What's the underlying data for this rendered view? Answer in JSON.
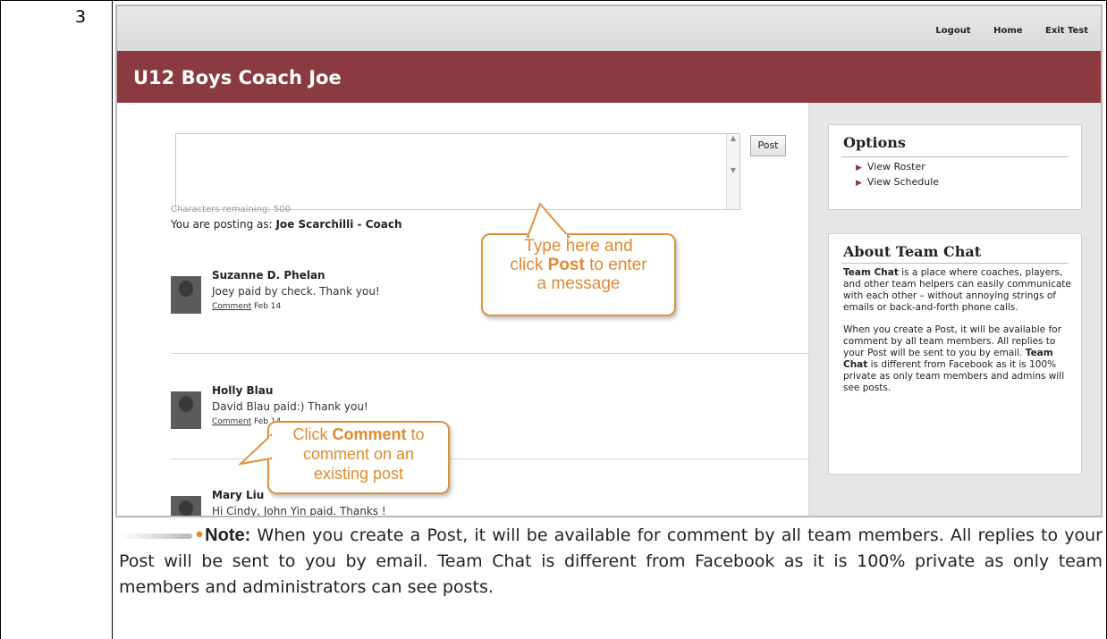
{
  "step_number": "3",
  "app": {
    "top_links": [
      "Logout",
      "Home",
      "Exit Test"
    ],
    "banner_title": "U12 Boys Coach Joe",
    "post_button": "Post",
    "chars_remaining": "Characters remaining: 500",
    "posting_as_prefix": "You are posting as: ",
    "posting_as_name": "Joe Scarchilli - Coach",
    "posts": [
      {
        "name": "Suzanne D. Phelan",
        "text": "Joey paid by check. Thank you!",
        "comment_label": "Comment",
        "date": "Feb 14"
      },
      {
        "name": "Holly Blau",
        "text": "David Blau paid:) Thank you!",
        "comment_label": "Comment",
        "date": "Feb 14"
      },
      {
        "name": "Mary Liu",
        "text": "Hi Cindy, John Yin paid. Thanks !",
        "comment_label": "",
        "date": ""
      }
    ]
  },
  "sidebar": {
    "options_title": "Options",
    "options": [
      "View Roster",
      "View Schedule"
    ],
    "about_title": "About Team Chat",
    "about_p1_bold": "Team Chat",
    "about_p1_rest": " is a place where coaches, players, and other team helpers can easily communicate with each other – without annoying strings of emails or back-and-forth phone calls.",
    "about_p2_a": "When you create a Post, it will be available for comment by all team members. All replies to your Post will be sent to you by email. ",
    "about_p2_bold": "Team Chat",
    "about_p2_b": " is different from Facebook as it is 100% private as only team members and admins will see posts."
  },
  "callouts": {
    "post_line1": "Type here and",
    "post_line2_a": "click ",
    "post_line2_bold": "Post",
    "post_line2_b": " to enter",
    "post_line3": "a message",
    "comment_line1_a": "Click ",
    "comment_line1_bold": "Comment",
    "comment_line1_b": " to",
    "comment_line2": "comment on an",
    "comment_line3": "existing post"
  },
  "note": {
    "label": "Note:",
    "text": " When you create a Post, it will be available for comment by all team members. All replies to your Post will be sent to you by email. Team Chat is different from Facebook as it is 100% private as only team members and administrators can see posts."
  },
  "colors": {
    "banner": "#8b3a3f",
    "callout": "#e08a2f"
  }
}
